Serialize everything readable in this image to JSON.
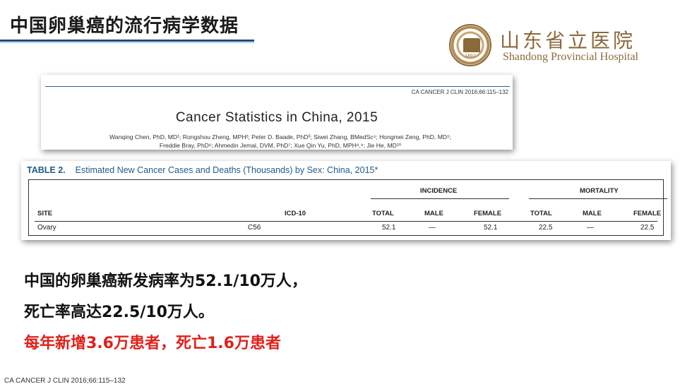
{
  "slide": {
    "title": "中国卵巢癌的流行病学数据",
    "footer_citation": "CA CANCER J CLIN 2016;66:115–132"
  },
  "logo": {
    "name_cn": "山东省立医院",
    "name_en": "Shandong Provincial Hospital",
    "seal_year": "1897"
  },
  "paper": {
    "journal": "CA CANCER J CLIN 2016;66:115–132",
    "title": "Cancer Statistics in China, 2015",
    "authors_line1": "Wanqing Chen, PhD, MD¹; Rongshou Zheng, MPH²; Peter D. Baade, PhD³; Siwei Zhang, BMedSc⁴; Hongmei Zeng, PhD, MD⁵;",
    "authors_line2": "Freddie Bray, PhD⁶; Ahmedin Jemal, DVM, PhD⁷; Xue Qin Yu, PhD, MPH⁸,⁹; Jie He, MD¹⁰"
  },
  "table": {
    "label": "TABLE 2.",
    "caption": "Estimated New Cancer Cases and Deaths (Thousands) by Sex: China, 2015*",
    "group_incidence": "INCIDENCE",
    "group_mortality": "MORTALITY",
    "headers": [
      "SITE",
      "ICD-10",
      "TOTAL",
      "MALE",
      "FEMALE",
      "TOTAL",
      "MALE",
      "FEMALE"
    ],
    "row": [
      "Ovary",
      "C56",
      "52.1",
      "—",
      "52.1",
      "22.5",
      "—",
      "22.5"
    ]
  },
  "statements": {
    "line1": "中国的卵巢癌新发病率为52.1/10万人，",
    "line2": "死亡率高达22.5/10万人。",
    "line3": "每年新增3.6万患者，死亡1.6万患者"
  },
  "colors": {
    "highlight_red": "#e0201a",
    "caption_blue": "#1f5c8c",
    "title_rule": "#1e4d7b",
    "logo_gold": "#8a6a3a"
  }
}
